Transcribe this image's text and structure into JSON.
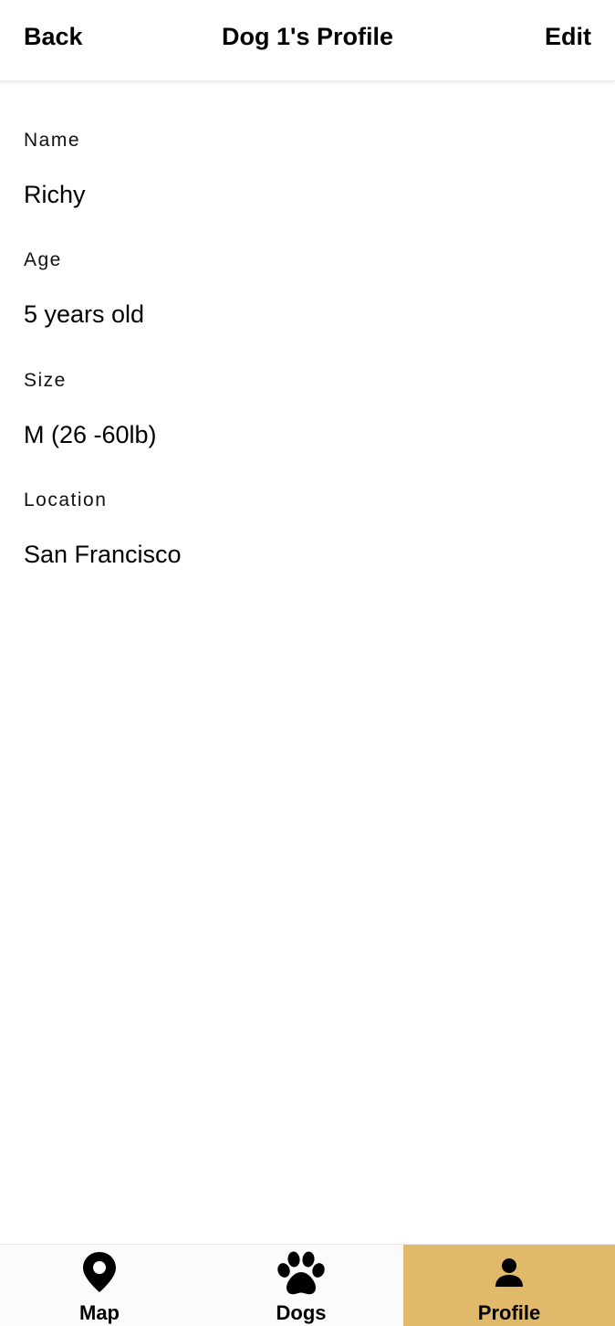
{
  "header": {
    "back_label": "Back",
    "title": "Dog 1's Profile",
    "edit_label": "Edit"
  },
  "fields": [
    {
      "label": "Name",
      "value": "Richy"
    },
    {
      "label": "Age",
      "value": "5 years old"
    },
    {
      "label": "Size",
      "value": "M (26 -60lb)"
    },
    {
      "label": "Location",
      "value": "San Francisco"
    }
  ],
  "tabbar": {
    "tabs": [
      {
        "label": "Map",
        "icon": "map-pin-icon",
        "active": false
      },
      {
        "label": "Dogs",
        "icon": "paw-icon",
        "active": false
      },
      {
        "label": "Profile",
        "icon": "person-icon",
        "active": true
      }
    ],
    "active_color": "#e0b96b"
  }
}
